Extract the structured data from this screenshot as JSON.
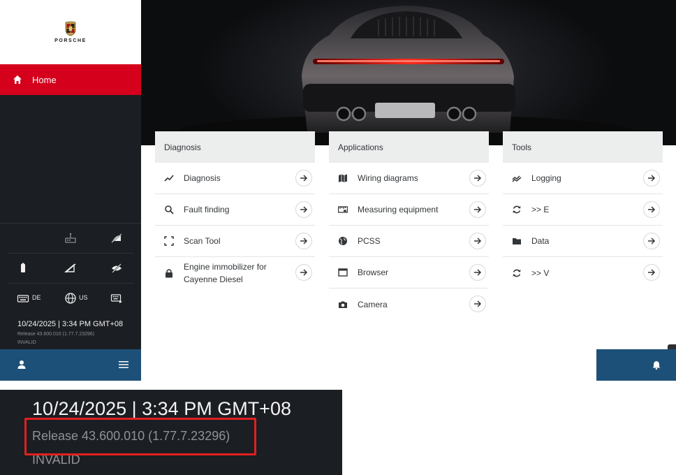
{
  "sidebar": {
    "logo_text": "PORSCHE",
    "home_label": "Home",
    "lang_keyboard": "DE",
    "lang_region": "US",
    "datetime": "10/24/2025 | 3:34 PM GMT+08",
    "release": "Release 43.600.010 (1.77.7.23296)",
    "status": "INVALID"
  },
  "panels": [
    {
      "title": "Diagnosis",
      "items": [
        {
          "label": "Diagnosis",
          "icon": "trend-icon"
        },
        {
          "label": "Fault finding",
          "icon": "search-icon"
        },
        {
          "label": "Scan Tool",
          "icon": "scan-frame-icon"
        },
        {
          "label": "Engine immobilizer for Cayenne Diesel",
          "icon": "lock-icon"
        }
      ]
    },
    {
      "title": "Applications",
      "items": [
        {
          "label": "Wiring diagrams",
          "icon": "map-icon"
        },
        {
          "label": "Measuring equipment",
          "icon": "measure-icon"
        },
        {
          "label": "PCSS",
          "icon": "globe-icon"
        },
        {
          "label": "Browser",
          "icon": "browser-icon"
        },
        {
          "label": "Camera",
          "icon": "camera-icon"
        }
      ]
    },
    {
      "title": "Tools",
      "items": [
        {
          "label": "Logging",
          "icon": "logging-icon"
        },
        {
          "label": ">> E",
          "icon": "sync-icon"
        },
        {
          "label": "Data",
          "icon": "folder-icon"
        },
        {
          "label": ">> V",
          "icon": "sync-icon"
        }
      ]
    }
  ],
  "zoom": {
    "datetime": "10/24/2025 | 3:34 PM GMT+08",
    "release": "Release 43.600.010 (1.77.7.23296)",
    "status": "INVALID"
  },
  "colors": {
    "brand_red": "#d5001c",
    "sidebar_dark": "#1b1e22",
    "bar_blue": "#1d5078",
    "highlight_red": "#e0201f"
  }
}
